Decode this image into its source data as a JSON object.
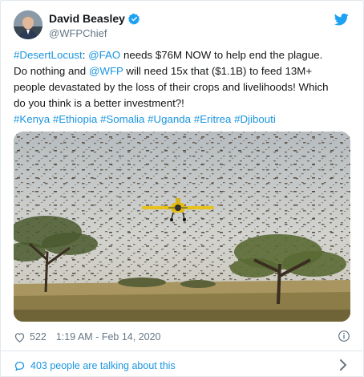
{
  "author": {
    "name": "David Beasley",
    "handle": "@WFPChief"
  },
  "tweet": {
    "line1_tag": "#DesertLocust",
    "line1_sep": ": ",
    "line1_mention": "@FAO",
    "line1_rest": " needs $76M NOW to help end the plague.",
    "line2_pre": "Do nothing and ",
    "line2_mention": "@WFP",
    "line2_rest": " will need 15x that ($1.1B) to feed 13M+",
    "line3": "people devastated by the loss of their crops and livelihoods! Which",
    "line4": "do you think is a better investment?!",
    "hashtags": [
      "#Kenya",
      "#Ethiopia",
      "#Somalia",
      "#Uganda",
      "#Eritrea",
      "#Djibouti"
    ]
  },
  "meta": {
    "likes": "522",
    "timestamp": "1:19 AM - Feb 14, 2020"
  },
  "footer": {
    "talking": "403 people are talking about this"
  },
  "colors": {
    "link": "#1b95e0",
    "text": "#14171a",
    "muted": "#657786",
    "border": "#e1e8ed"
  },
  "icons": [
    "avatar",
    "verified-badge-icon",
    "twitter-bird-icon",
    "heart-icon",
    "info-icon",
    "comment-bubble-icon",
    "chevron-right-icon"
  ]
}
